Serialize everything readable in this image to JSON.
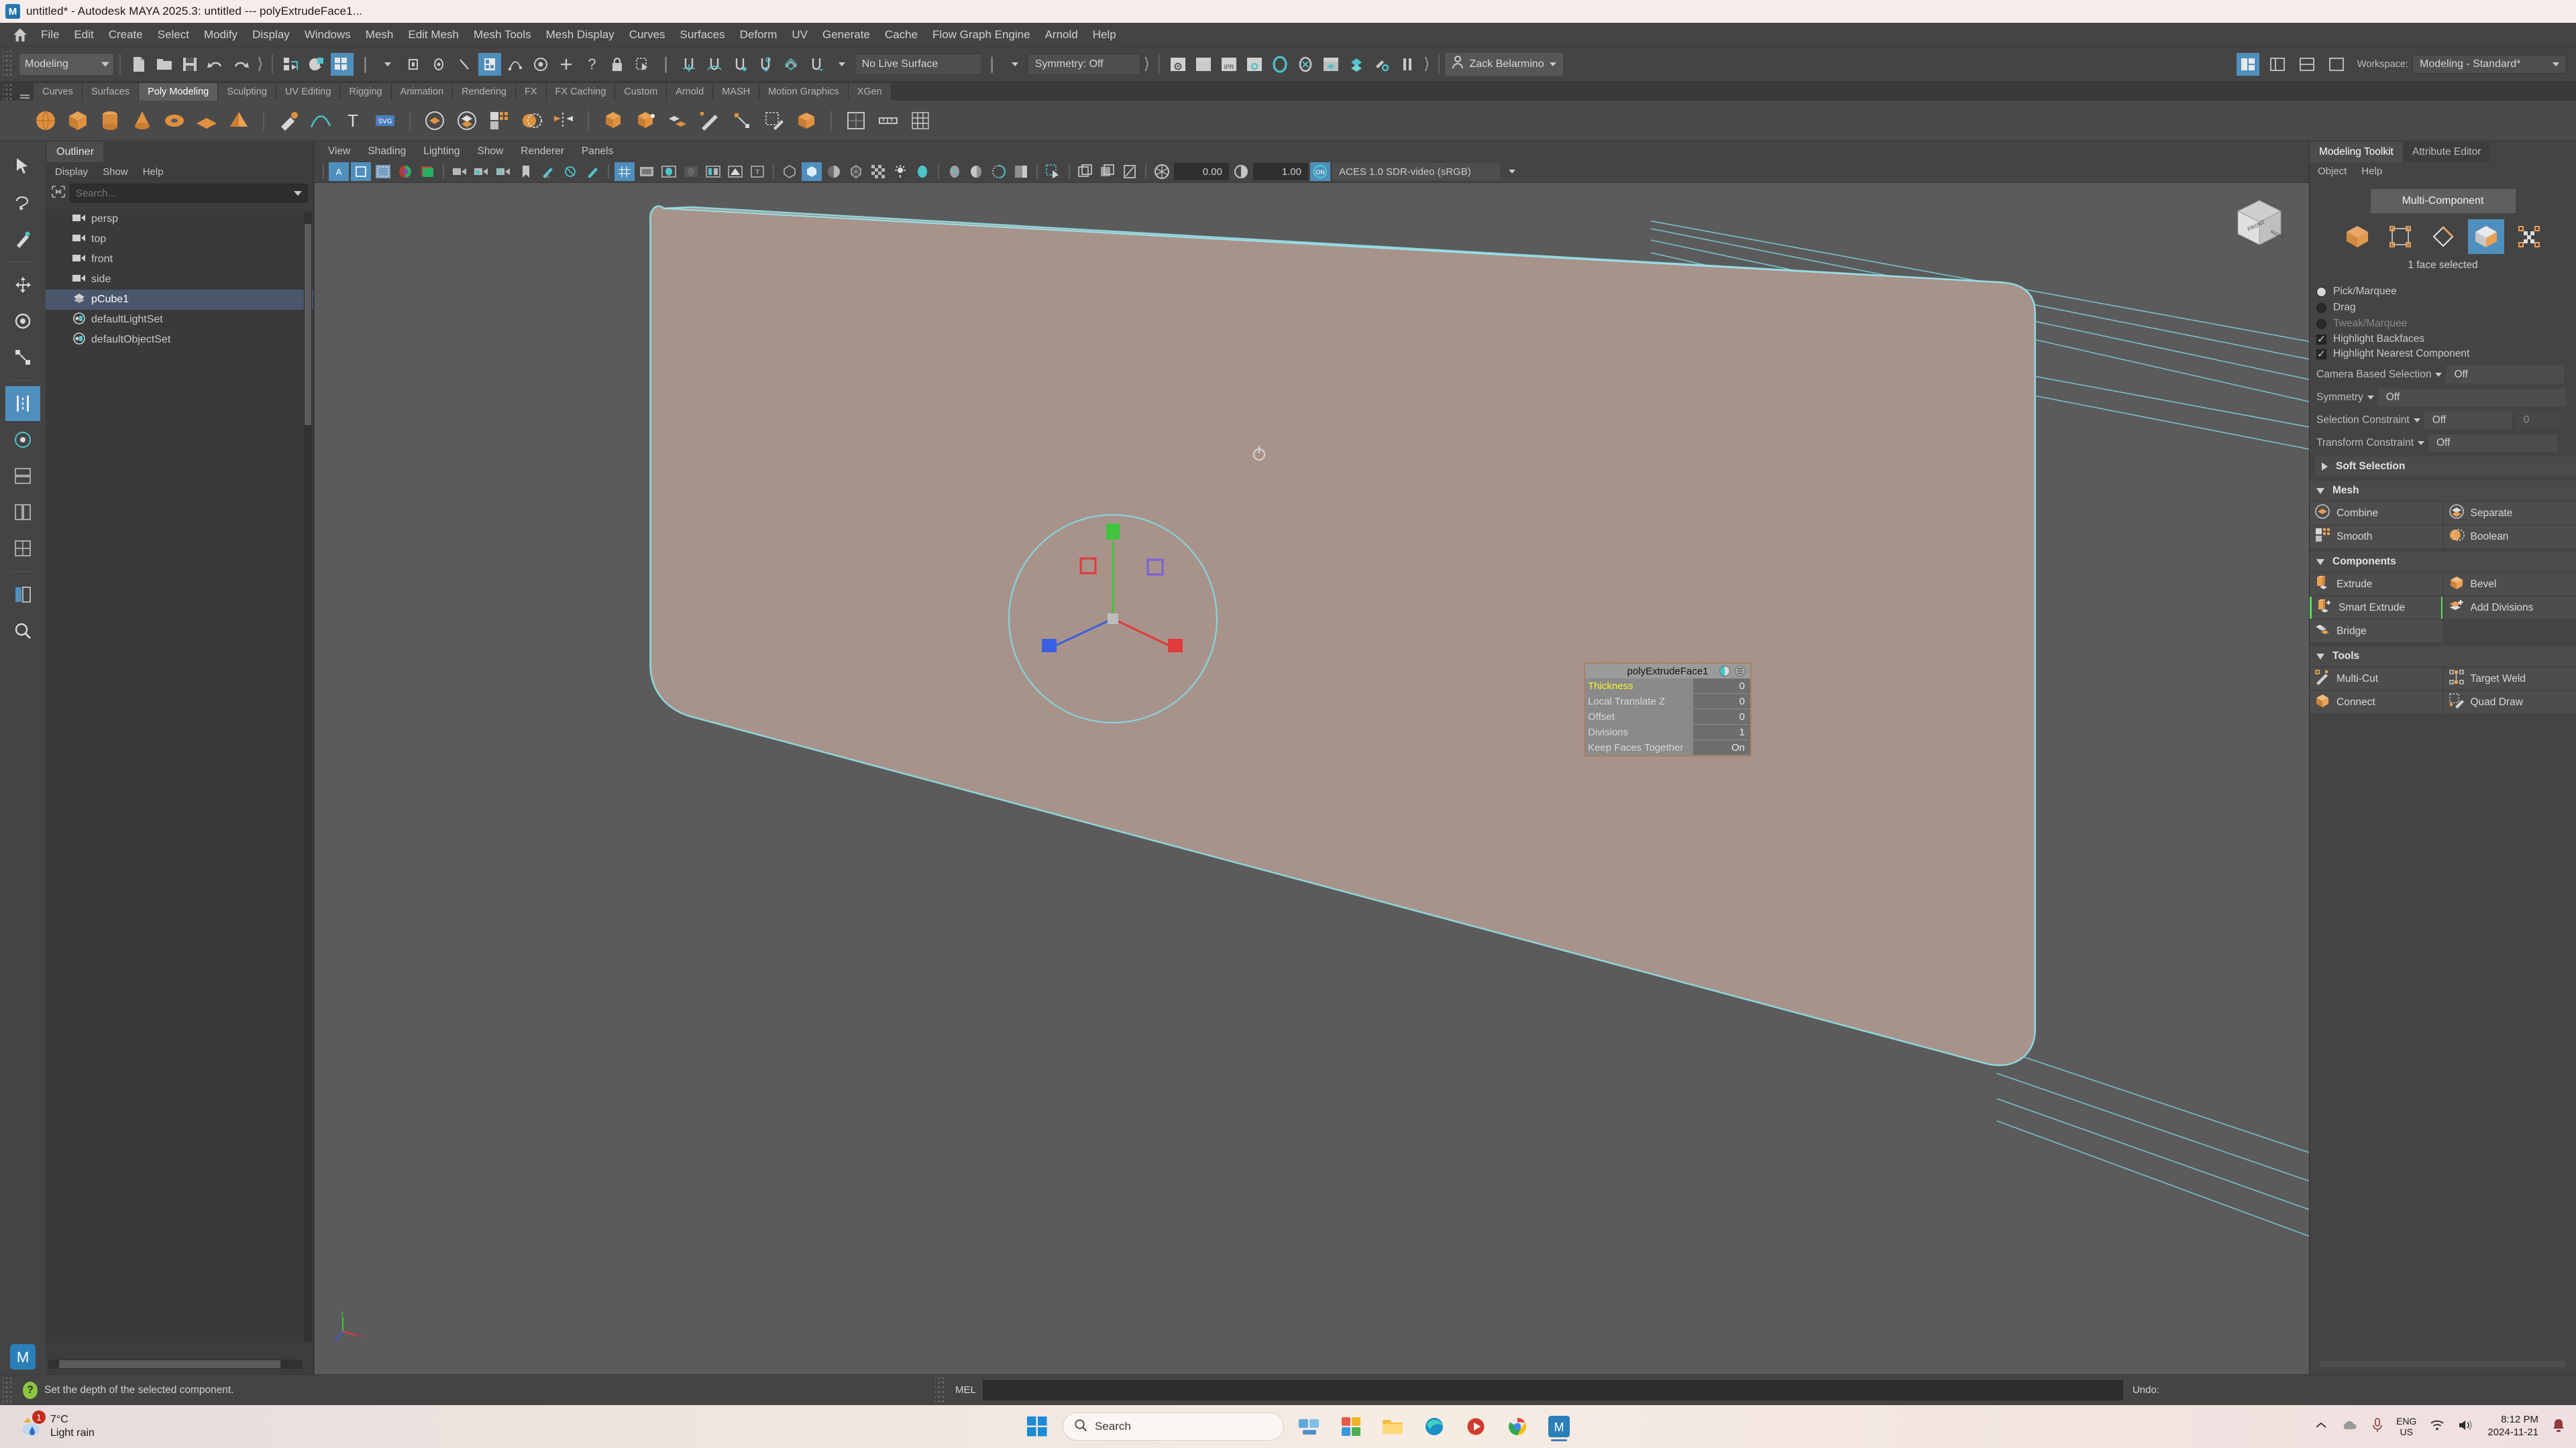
{
  "window": {
    "title": "untitled* - Autodesk MAYA 2025.3: untitled   ---   polyExtrudeFace1...",
    "app_icon": "maya-logo-icon"
  },
  "main_menu": {
    "home_icon": "home-icon",
    "items": [
      "File",
      "Edit",
      "Create",
      "Select",
      "Modify",
      "Display",
      "Windows",
      "Mesh",
      "Edit Mesh",
      "Mesh Tools",
      "Mesh Display",
      "Curves",
      "Surfaces",
      "Deform",
      "UV",
      "Generate",
      "Cache",
      "Flow Graph Engine",
      "Arnold",
      "Help"
    ]
  },
  "status_line": {
    "menu_set": "Modeling",
    "live_surface": "No Live Surface",
    "symmetry": "Symmetry: Off",
    "user": "Zack Belarmino",
    "workspace_label": "Workspace:",
    "workspace_value": "Modeling - Standard*"
  },
  "shelf": {
    "tabs": [
      "Curves",
      "Surfaces",
      "Poly Modeling",
      "Sculpting",
      "UV Editing",
      "Rigging",
      "Animation",
      "Rendering",
      "FX",
      "FX Caching",
      "Custom",
      "Arnold",
      "MASH",
      "Motion Graphics",
      "XGen"
    ],
    "selected_tab": "Poly Modeling"
  },
  "outliner": {
    "tab_label": "Outliner",
    "menu": [
      "Display",
      "Show",
      "Help"
    ],
    "search_placeholder": "Search...",
    "items": [
      {
        "label": "persp",
        "icon": "camera-icon",
        "selected": false
      },
      {
        "label": "top",
        "icon": "camera-icon",
        "selected": false
      },
      {
        "label": "front",
        "icon": "camera-icon",
        "selected": false
      },
      {
        "label": "side",
        "icon": "camera-icon",
        "selected": false
      },
      {
        "label": "pCube1",
        "icon": "mesh-icon",
        "selected": true
      },
      {
        "label": "defaultLightSet",
        "icon": "set-icon",
        "selected": false
      },
      {
        "label": "defaultObjectSet",
        "icon": "set-icon",
        "selected": false
      }
    ]
  },
  "viewport": {
    "menu": [
      "View",
      "Shading",
      "Lighting",
      "Show",
      "Renderer",
      "Panels"
    ],
    "exposure": "0.00",
    "gamma": "1.00",
    "color_toggle": "ON",
    "color_space": "ACES 1.0 SDR-video (sRGB)",
    "viewcube_front": "FRONT",
    "viewcube_right": "RIGHT",
    "mesh_color": "#a8938a"
  },
  "tool_hud": {
    "title": "polyExtrudeFace1",
    "rows": [
      {
        "label": "Thickness",
        "value": "0",
        "highlight": true
      },
      {
        "label": "Local Translate Z",
        "value": "0",
        "highlight": false
      },
      {
        "label": "Offset",
        "value": "0",
        "highlight": false
      },
      {
        "label": "Divisions",
        "value": "1",
        "highlight": false
      },
      {
        "label": "Keep Faces Together",
        "value": "On",
        "highlight": false
      }
    ]
  },
  "modeling_toolkit": {
    "tabs": [
      {
        "label": "Modeling Toolkit",
        "selected": true
      },
      {
        "label": "Attribute Editor",
        "selected": false
      }
    ],
    "menu": [
      "Object",
      "Help"
    ],
    "multi_component": "Multi-Component",
    "component_icons": [
      {
        "name": "object-mode-icon",
        "active": false
      },
      {
        "name": "vertex-mode-icon",
        "active": false
      },
      {
        "name": "edge-mode-icon",
        "active": false
      },
      {
        "name": "face-mode-icon",
        "active": true
      },
      {
        "name": "uv-mode-icon",
        "active": false
      }
    ],
    "selection_status": "1 face selected",
    "radios": [
      {
        "label": "Pick/Marquee",
        "on": true,
        "dim": false
      },
      {
        "label": "Drag",
        "on": false,
        "dim": false
      },
      {
        "label": "Tweak/Marquee",
        "on": false,
        "dim": true
      }
    ],
    "checkboxes": [
      {
        "label": "Highlight Backfaces",
        "checked": true
      },
      {
        "label": "Highlight Nearest Component",
        "checked": true
      }
    ],
    "options": [
      {
        "label": "Camera Based Selection",
        "value": "Off",
        "extra": null
      },
      {
        "label": "Symmetry",
        "value": "Off",
        "extra": null
      },
      {
        "label": "Selection Constraint",
        "value": "Off",
        "extra": "0"
      },
      {
        "label": "Transform Constraint",
        "value": "Off",
        "extra": null
      }
    ],
    "soft_selection": "Soft Selection",
    "sections": [
      {
        "title": "Mesh",
        "buttons": [
          {
            "label": "Combine",
            "icon": "combine-icon",
            "highlight": false
          },
          {
            "label": "Separate",
            "icon": "separate-icon",
            "highlight": false
          },
          {
            "label": "Smooth",
            "icon": "smooth-icon",
            "highlight": false
          },
          {
            "label": "Boolean",
            "icon": "boolean-icon",
            "highlight": false
          }
        ]
      },
      {
        "title": "Components",
        "buttons": [
          {
            "label": "Extrude",
            "icon": "extrude-icon",
            "highlight": false
          },
          {
            "label": "Bevel",
            "icon": "bevel-icon",
            "highlight": false
          },
          {
            "label": "Smart Extrude",
            "icon": "smart-extrude-icon",
            "highlight": true
          },
          {
            "label": "Add Divisions",
            "icon": "add-divisions-icon",
            "highlight": false
          },
          {
            "label": "Bridge",
            "icon": "bridge-icon",
            "highlight": false
          },
          {
            "label": "",
            "icon": "",
            "highlight": false
          }
        ]
      },
      {
        "title": "Tools",
        "buttons": [
          {
            "label": "Multi-Cut",
            "icon": "multi-cut-icon",
            "highlight": false
          },
          {
            "label": "Target Weld",
            "icon": "target-weld-icon",
            "highlight": false
          },
          {
            "label": "Connect",
            "icon": "connect-icon",
            "highlight": false
          },
          {
            "label": "Quad Draw",
            "icon": "quad-draw-icon",
            "highlight": false
          }
        ]
      }
    ]
  },
  "help_line": {
    "message": "Set the depth of the selected component.",
    "command_label": "MEL",
    "command_value": "",
    "undo_label": "Undo:"
  },
  "taskbar": {
    "weather_temp": "7°C",
    "weather_desc": "Light rain",
    "weather_badge": "1",
    "search_placeholder": "Search",
    "lang_line1": "ENG",
    "lang_line2": "US",
    "time": "8:12 PM",
    "date": "2024-11-21",
    "apps": [
      "start-icon",
      "search-pill",
      "task-view-icon",
      "widgets-icon",
      "file-explorer-icon",
      "edge-icon",
      "media-icon",
      "chrome-icon",
      "maya-icon"
    ]
  },
  "colors": {
    "accent_blue": "#4f8fbd",
    "maya_orange": "#e38b42",
    "panel_bg": "#444444",
    "viewport_bg": "#5b5b5b",
    "selection_blue": "#4a566b",
    "highlight_green": "#5ede5e",
    "hud_yellow": "#f6f32f"
  }
}
